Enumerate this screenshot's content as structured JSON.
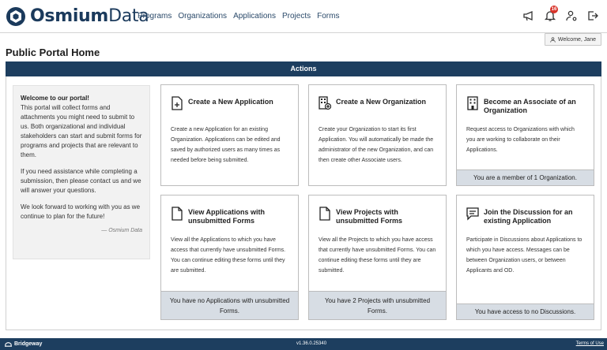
{
  "header": {
    "logo_text_bold": "Osmium",
    "logo_text_rest": "Data",
    "nav": [
      "Programs",
      "Organizations",
      "Applications",
      "Projects",
      "Forms"
    ],
    "icons": [
      "megaphone-icon",
      "bell-icon",
      "user-settings-icon",
      "logout-icon"
    ],
    "notification_count": "16"
  },
  "welcome": {
    "text": "Welcome, Jane"
  },
  "page": {
    "title": "Public Portal Home"
  },
  "actions": {
    "label": "Actions"
  },
  "intro": {
    "title": "Welcome to our portal!",
    "p1": "This portal will collect forms and attachments you might need to submit to us. Both organizational and individual stakeholders can start and submit forms for programs and projects that are relevant to them.",
    "p2": "If you need assistance while completing a submission, then please contact us and we will answer your questions.",
    "p3": "We look forward to working with you as we continue to plan for the future!",
    "signature": "— Osmium Data"
  },
  "cards": [
    {
      "title": "Create a New Application",
      "desc": "Create a new Application for an existing Organization. Applications can be edited and saved by authorized users as many times as needed before being submitted.",
      "footer": ""
    },
    {
      "title": "Create a New Organization",
      "desc": "Create your Organization to start its first Application. You will automatically be made the administrator of the new Organization, and can then create other Associate users.",
      "footer": ""
    },
    {
      "title": "Become an Associate of an Organization",
      "desc": "Request access to Organizations with which you are working to collaborate on their Applications.",
      "footer": "You are a member of 1 Organization."
    },
    {
      "title": "View Applications with unsubmitted Forms",
      "desc": "View all the Applications to which you have access that currently have unsubmitted Forms. You can continue editing these forms until they are submitted.",
      "footer": "You have no Applications with unsubmitted Forms."
    },
    {
      "title": "View Projects with unsubmitted Forms",
      "desc": "View all the Projects to which you have access that currently have unsubmitted Forms. You can continue editing these forms until they are submitted.",
      "footer": "You have 2 Projects with unsubmitted Forms."
    },
    {
      "title": "Join the Discussion for an existing Application",
      "desc": "Participate in Discussions about Applications to which you have access. Messages can be between Organization users, or between Applicants and OD.",
      "footer": "You have access to no Discussions."
    }
  ],
  "footer": {
    "brand": "Bridgeway",
    "version": "v1.36.0.25340",
    "terms": "Terms of Use"
  },
  "colors": {
    "navy": "#1d3e5f",
    "footer_panel": "#d7dde4",
    "badge": "#d9342b"
  }
}
